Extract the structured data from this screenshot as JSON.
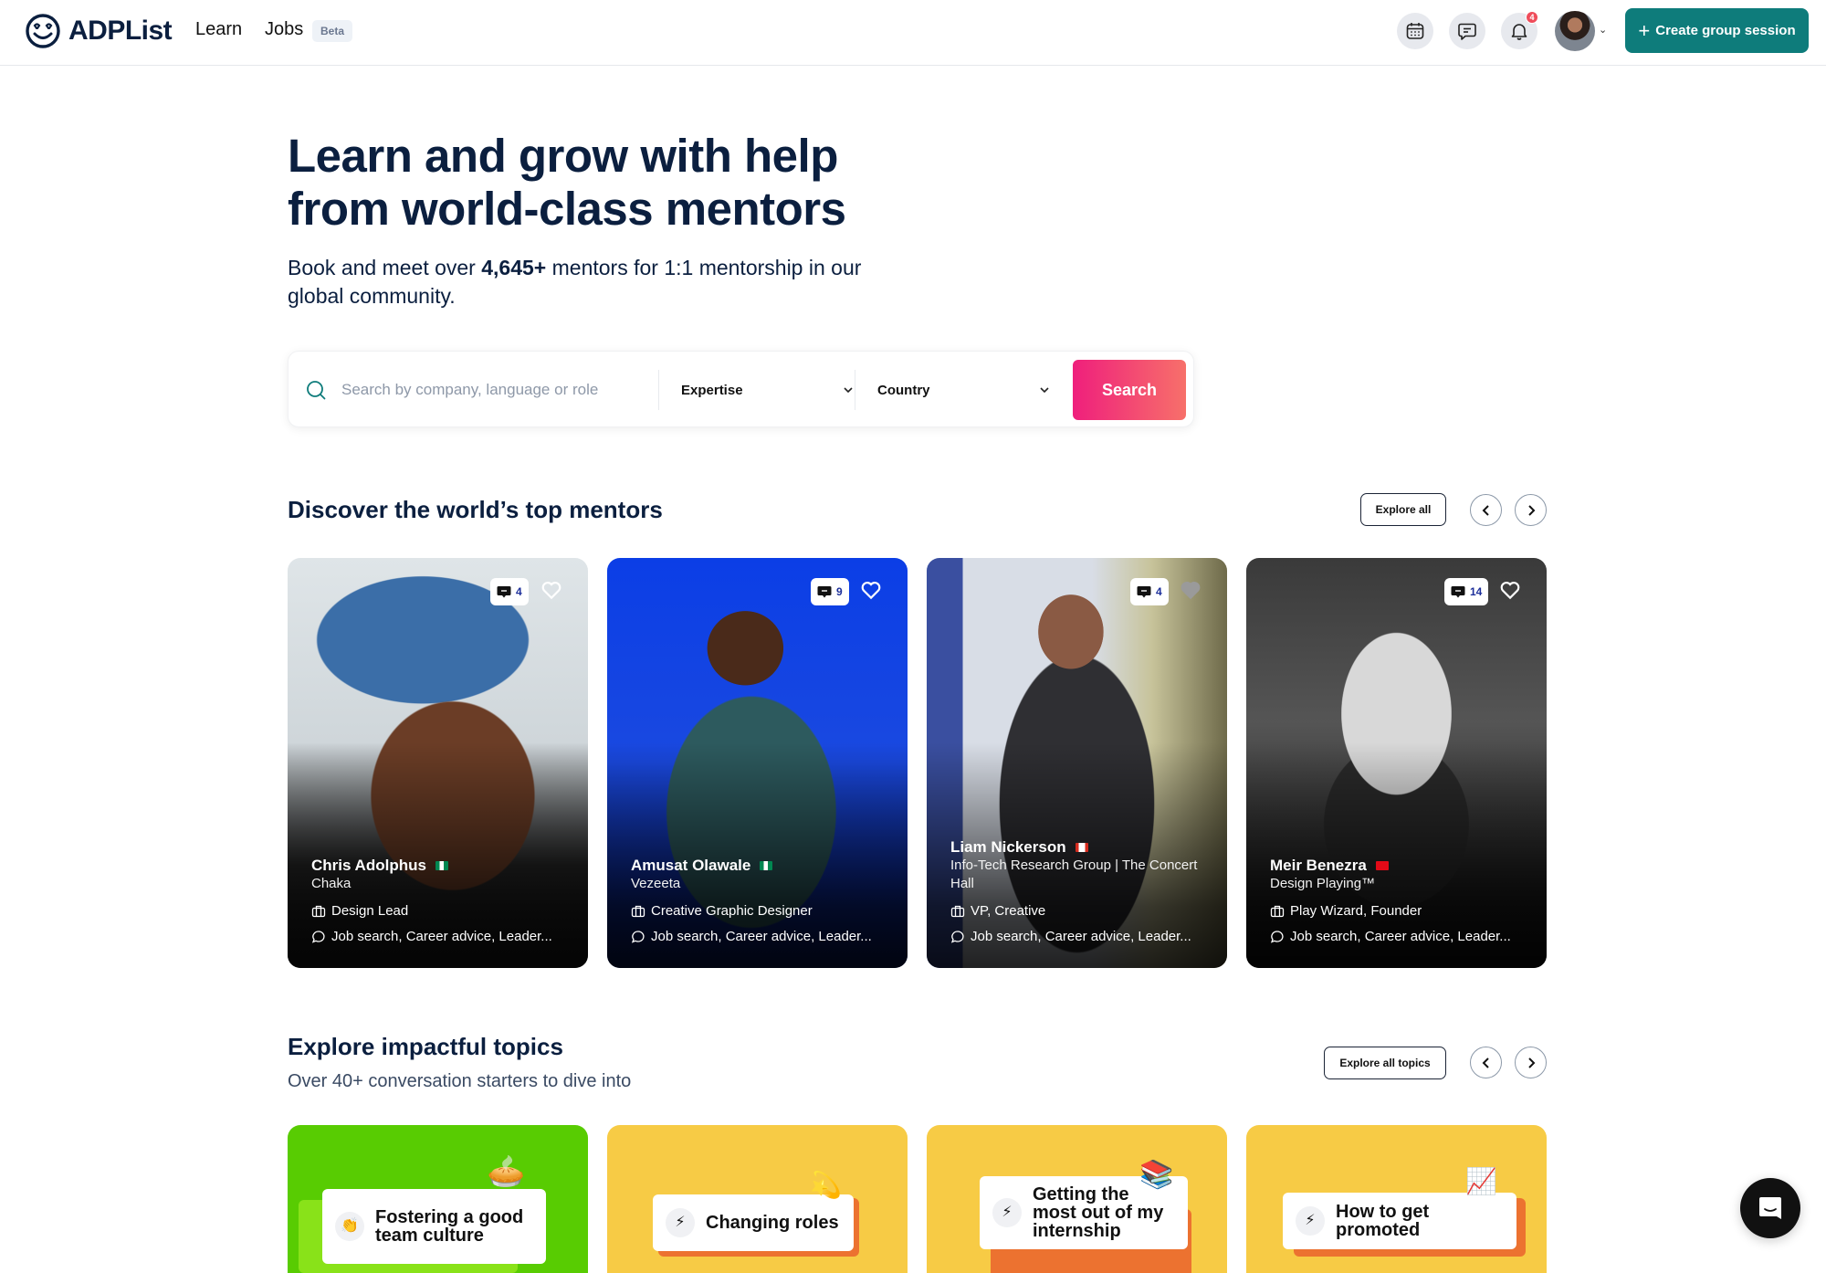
{
  "header": {
    "brand": "ADPList",
    "nav": [
      {
        "label": "Learn"
      },
      {
        "label": "Jobs",
        "badge": "Beta"
      }
    ],
    "icons": [
      "calendar-icon",
      "messages-icon",
      "bell-icon"
    ],
    "notification_count": "4",
    "create_button": "Create group session",
    "accent_color": "#0e7c7b"
  },
  "hero": {
    "title_line1": "Learn and grow with help",
    "title_line2": "from world-class mentors",
    "sub_before": "Book and meet over ",
    "sub_count": "4,645+",
    "sub_after": " mentors for 1:1 mentorship in our global community."
  },
  "search": {
    "placeholder": "Search by company, language or role",
    "value": "",
    "expertise_label": "Expertise",
    "country_label": "Country",
    "button": "Search"
  },
  "mentors_section": {
    "title": "Discover the world’s top mentors",
    "explore_button": "Explore all",
    "mentors": [
      {
        "name": "Chris Adolphus",
        "flag": "NG",
        "company": "Chaka",
        "role": "Design Lead",
        "topics": "Job search, Career advice, Leader...",
        "messages": "4",
        "heart_filled": false
      },
      {
        "name": "Amusat Olawale",
        "flag": "NG",
        "company": "Vezeeta",
        "role": "Creative Graphic Designer",
        "topics": "Job search, Career advice, Leader...",
        "messages": "9",
        "heart_filled": false
      },
      {
        "name": "Liam Nickerson",
        "flag": "CA",
        "company": "Info-Tech Research Group | The Concert Hall",
        "role": "VP, Creative",
        "topics": "Job search, Career advice, Leader...",
        "messages": "4",
        "heart_filled": true
      },
      {
        "name": "Meir Benezra",
        "flag": "TR",
        "company": "Design Playing™",
        "role": "Play Wizard, Founder",
        "topics": "Job search, Career advice, Leader...",
        "messages": "14",
        "heart_filled": false
      }
    ]
  },
  "topics_section": {
    "title": "Explore impactful topics",
    "subtitle": "Over 40+ conversation starters to dive into",
    "explore_button": "Explore all topics",
    "topics": [
      {
        "label": "Fostering a good team culture",
        "icon": "👏",
        "deco": "🥧",
        "bg": "#58cc02"
      },
      {
        "label": "Changing roles",
        "icon": "⚡",
        "deco": "💫",
        "bg": "#f7cb45"
      },
      {
        "label": "Getting the most out of my internship",
        "icon": "⚡",
        "deco": "📚",
        "bg": "#f7cb45"
      },
      {
        "label": "How to get promoted",
        "icon": "⚡",
        "deco": "📈",
        "bg": "#f7cb45"
      }
    ]
  }
}
